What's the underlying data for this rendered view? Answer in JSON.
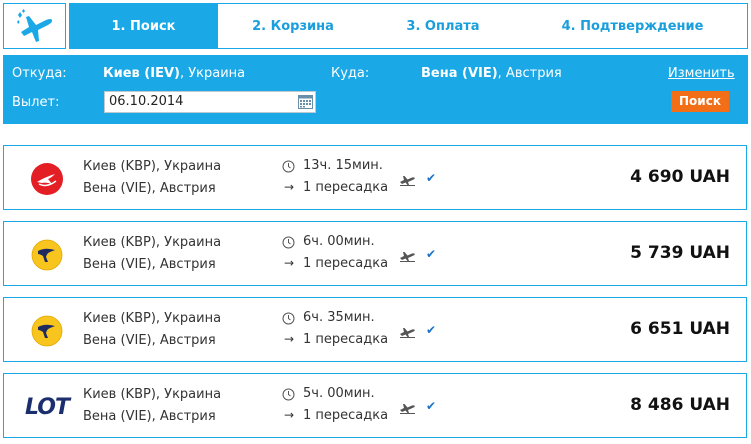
{
  "steps": [
    {
      "label": "1. Поиск",
      "active": true
    },
    {
      "label": "2. Корзина",
      "active": false
    },
    {
      "label": "3. Оплата",
      "active": false
    },
    {
      "label": "4. Подтверждение",
      "active": false
    }
  ],
  "search": {
    "from_label": "Откуда:",
    "from_city": "Киев (IEV)",
    "from_country": ", Украина",
    "to_label": "Куда:",
    "to_city": "Вена (VIE)",
    "to_country": ", Австрия",
    "date_label": "Вылет:",
    "date_value": "06.10.2014",
    "change_label": "Изменить",
    "search_button": "Поиск"
  },
  "results": [
    {
      "airline_icon": "turkish-airlines-logo",
      "from": "Киев (KBP), Украина",
      "to": "Вена (VIE), Австрия",
      "duration": "13ч. 15мин.",
      "stops": "1 пересадка",
      "price": "4 690 UAH"
    },
    {
      "airline_icon": "ukraine-international-logo",
      "from": "Киев (KBP), Украина",
      "to": "Вена (VIE), Австрия",
      "duration": "6ч. 00мин.",
      "stops": "1 пересадка",
      "price": "5 739 UAH"
    },
    {
      "airline_icon": "ukraine-international-logo",
      "from": "Киев (KBP), Украина",
      "to": "Вена (VIE), Австрия",
      "duration": "6ч. 35мин.",
      "stops": "1 пересадка",
      "price": "6 651 UAH"
    },
    {
      "airline_icon": "lot-logo",
      "logo_text": "LOT",
      "from": "Киев (KBP), Украина",
      "to": "Вена (VIE), Австрия",
      "duration": "5ч. 00мин.",
      "stops": "1 пересадка",
      "price": "8 486 UAH"
    }
  ],
  "colors": {
    "accent": "#1aa8e6",
    "button": "#f26f17",
    "check": "#1a73c8"
  }
}
